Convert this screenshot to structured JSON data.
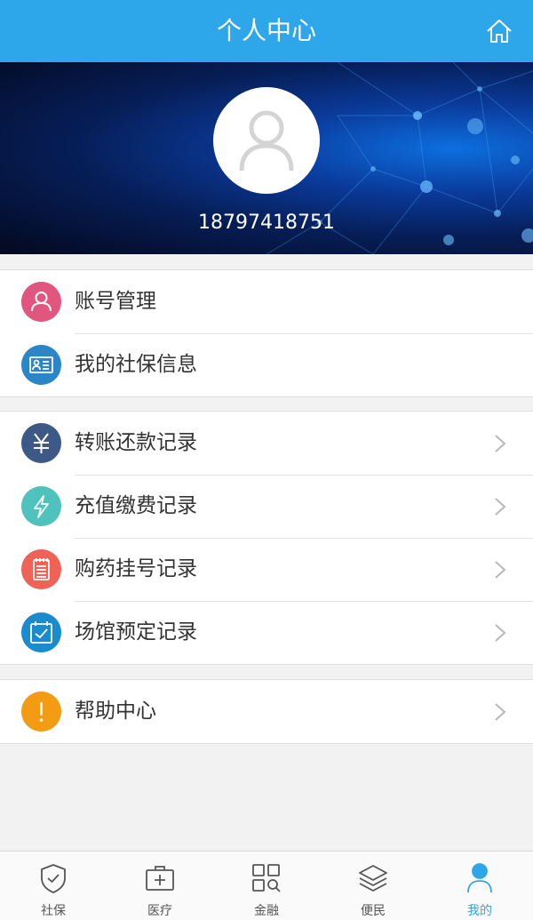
{
  "header": {
    "title": "个人中心",
    "home_icon": "home-icon"
  },
  "profile": {
    "phone": "18797418751",
    "avatar_icon": "user-avatar-icon"
  },
  "menu_groups": [
    {
      "items": [
        {
          "label": "账号管理",
          "icon": "user-icon",
          "color": "#e0567f"
        },
        {
          "label": "我的社保信息",
          "icon": "id-card-icon",
          "color": "#2a86c6"
        }
      ]
    },
    {
      "items": [
        {
          "label": "转账还款记录",
          "icon": "yen-icon",
          "color": "#3d5a87"
        },
        {
          "label": "充值缴费记录",
          "icon": "lightning-icon",
          "color": "#4fc2bd"
        },
        {
          "label": "购药挂号记录",
          "icon": "notepad-icon",
          "color": "#ef6356"
        },
        {
          "label": "场馆预定记录",
          "icon": "calendar-check-icon",
          "color": "#1a8bcf"
        }
      ]
    },
    {
      "items": [
        {
          "label": "帮助中心",
          "icon": "exclamation-icon",
          "color": "#f39b13"
        }
      ]
    }
  ],
  "tabbar": {
    "active_color": "#2ea7ea",
    "tabs": [
      {
        "label": "社保",
        "icon": "shield-check-icon"
      },
      {
        "label": "医疗",
        "icon": "medical-kit-icon"
      },
      {
        "label": "金融",
        "icon": "grid-search-icon"
      },
      {
        "label": "便民",
        "icon": "layers-icon"
      },
      {
        "label": "我的",
        "icon": "person-icon",
        "active": true
      }
    ]
  }
}
